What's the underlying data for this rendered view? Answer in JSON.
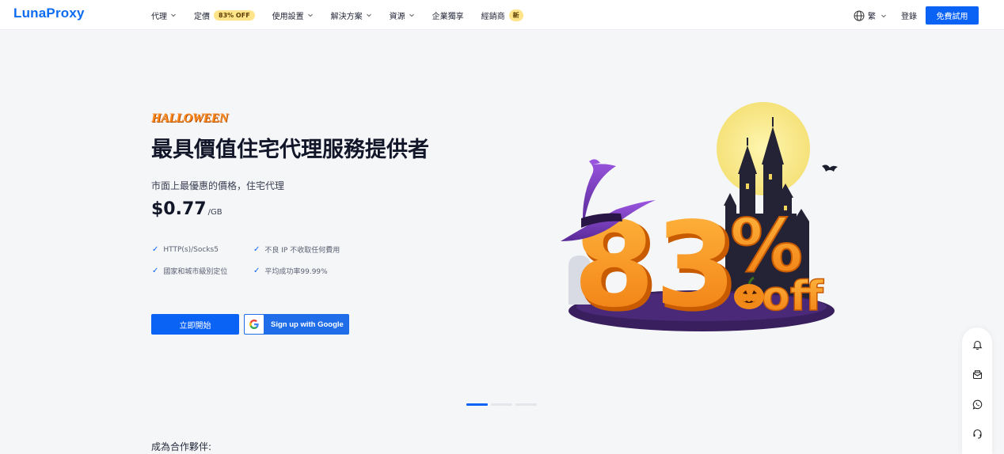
{
  "brand": {
    "logo": "LunaProxy",
    "accent": "#0b63f6"
  },
  "nav": {
    "items": [
      {
        "label": "代理",
        "has_dropdown": true
      },
      {
        "label": "定價",
        "badge": "83% OFF"
      },
      {
        "label": "使用設置",
        "has_dropdown": true
      },
      {
        "label": "解決方案",
        "has_dropdown": true
      },
      {
        "label": "資源",
        "has_dropdown": true
      },
      {
        "label": "企業獨享"
      },
      {
        "label": "經銷商",
        "badge": "新"
      }
    ],
    "language": "繁",
    "login": "登錄",
    "trial_button": "免費試用"
  },
  "hero": {
    "event_logo": "HALLOWEEN",
    "title": "最具價值住宅代理服務提供者",
    "subtitle": "市面上最優惠的價格，住宅代理",
    "price": "$0.77",
    "price_unit": "/GB",
    "features": [
      "HTTP(s)/Socks5",
      "不良 IP 不收取任何費用",
      "國家和城市級別定位",
      "平均成功率99.99%"
    ],
    "start_button": "立即開始",
    "google_button": "Sign up with Google"
  },
  "promo_art": {
    "number": "83",
    "percent": "%",
    "suffix": "off"
  },
  "carousel": {
    "slides": 3,
    "active": 1
  },
  "partner_heading": "成為合作夥伴:",
  "side_toolbar": [
    "bell-icon",
    "mail-icon",
    "whatsapp-icon",
    "headset-icon"
  ]
}
